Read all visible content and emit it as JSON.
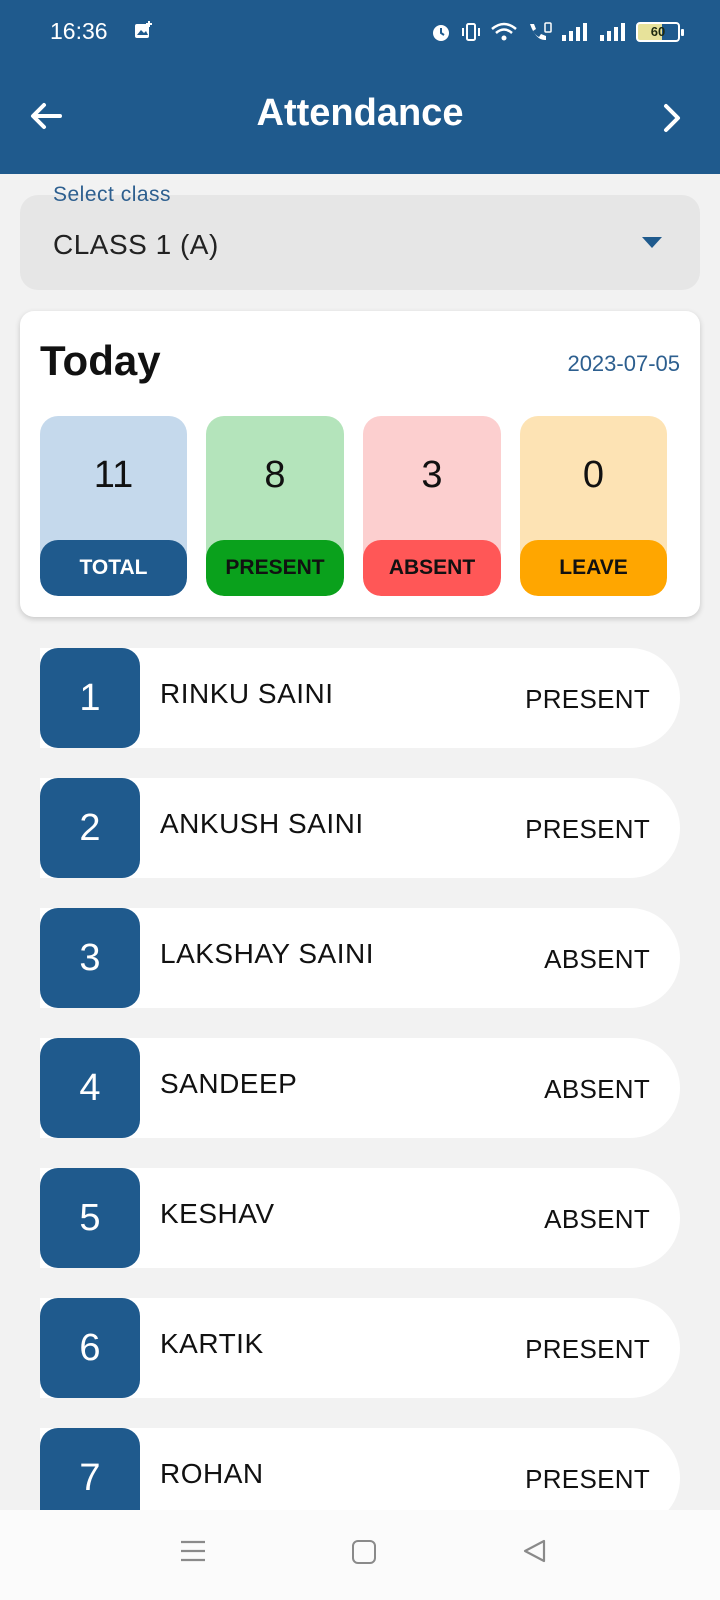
{
  "status_bar": {
    "time": "16:36",
    "battery": "60",
    "icons": [
      "image-add-icon",
      "alarm-icon",
      "vibrate-icon",
      "wifi-icon",
      "volte-call-icon",
      "signal-icon",
      "signal-icon",
      "battery-icon"
    ]
  },
  "app_bar": {
    "title": "Attendance",
    "back_icon": "arrow-left-icon",
    "next_icon": "chevron-right-icon"
  },
  "class_select": {
    "label": "Select class",
    "value": "CLASS 1 (A)"
  },
  "today": {
    "title": "Today",
    "date": "2023-07-05",
    "stats": [
      {
        "value": "11",
        "label": "TOTAL",
        "bg": "#c5d9ec",
        "label_bg": "#1f5a8d",
        "label_color": "#ffffff"
      },
      {
        "value": "8",
        "label": "PRESENT",
        "bg": "#b4e4bb",
        "label_bg": "#0aa11c",
        "label_color": "#111111"
      },
      {
        "value": "3",
        "label": "ABSENT",
        "bg": "#fccfcf",
        "label_bg": "#ff5757",
        "label_color": "#111111"
      },
      {
        "value": "0",
        "label": "LEAVE",
        "bg": "#fde3b4",
        "label_bg": "#ffa600",
        "label_color": "#111111"
      }
    ]
  },
  "students": [
    {
      "num": "1",
      "name": "RINKU SAINI",
      "status": "PRESENT"
    },
    {
      "num": "2",
      "name": "ANKUSH SAINI",
      "status": "PRESENT"
    },
    {
      "num": "3",
      "name": "LAKSHAY SAINI",
      "status": "ABSENT"
    },
    {
      "num": "4",
      "name": "SANDEEP",
      "status": "ABSENT"
    },
    {
      "num": "5",
      "name": "KESHAV",
      "status": "ABSENT"
    },
    {
      "num": "6",
      "name": "KARTIK",
      "status": "PRESENT"
    },
    {
      "num": "7",
      "name": "ROHAN",
      "status": "PRESENT"
    }
  ],
  "nav_bar": {
    "icons": [
      "menu-icon",
      "home-icon",
      "back-triangle-icon"
    ]
  },
  "colors": {
    "primary": "#1f5a8d",
    "background": "#f2f2f2"
  }
}
